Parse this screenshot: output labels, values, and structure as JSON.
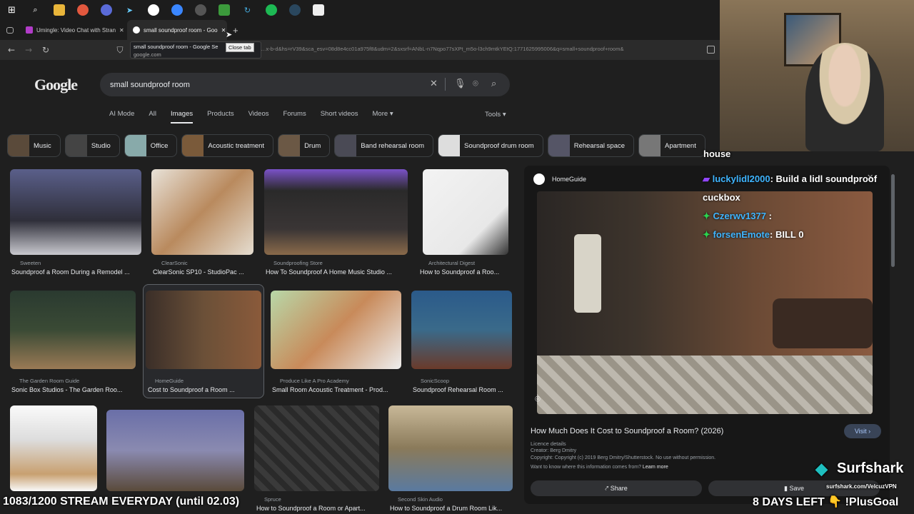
{
  "browser": {
    "tabs": [
      {
        "label": "Umingle: Video Chat with Stran",
        "active": false
      },
      {
        "label": "small soundproof room - Goo",
        "active": true
      }
    ],
    "new_tab": "+",
    "url": "…x-b-d&hs=rV39&sca_esv=08d8e4cc01a975f8&udm=2&sxsrf=ANbL-n7Nqpo77sXPt_m5o-l3ch9mtkYEtQ:1771625995006&q=small+soundproof+room&",
    "tooltip_title": "small soundproof room - Google Se",
    "tooltip_domain": "google.com",
    "close_tab_tip": "Close tab"
  },
  "google": {
    "logo": "Google",
    "query": "small soundproof room",
    "filters": [
      "AI Mode",
      "All",
      "Images",
      "Products",
      "Videos",
      "Forums",
      "Short videos",
      "More"
    ],
    "selected_filter": "Images",
    "tools": "Tools",
    "chips": [
      "Music",
      "Studio",
      "Office",
      "Acoustic treatment",
      "Drum",
      "Band rehearsal room",
      "Soundproof drum room",
      "Rehearsal space",
      "Apartment"
    ],
    "results": [
      {
        "source": "Sweeten",
        "title": "Soundproof a Room During a Remodel ..."
      },
      {
        "source": "ClearSonic",
        "title": "ClearSonic SP10 - StudioPac ..."
      },
      {
        "source": "Soundproofing Store",
        "title": "How To Soundproof A Home Music Studio ..."
      },
      {
        "source": "Architectural Digest",
        "title": "How to Soundproof a Roo..."
      },
      {
        "source": "The Garden Room Guide",
        "title": "Sonic Box Studios - The Garden Roo..."
      },
      {
        "source": "HomeGuide",
        "title": "Cost to Soundproof a Room ..."
      },
      {
        "source": "Produce Like A Pro Academy",
        "title": "Small Room Acoustic Treatment - Prod..."
      },
      {
        "source": "SonicScoop",
        "title": "Soundproof Rehearsal Room ..."
      },
      {
        "source": "Spruce",
        "title": "How to Soundproof a Room or Apart..."
      },
      {
        "source": "Second Skin Audio",
        "title": "How to Soundproof a Drum Room Lik..."
      }
    ],
    "panel": {
      "source": "HomeGuide",
      "title": "How Much Does It Cost to Soundproof a Room? (2026)",
      "visit": "Visit",
      "licence_label": "Licence details",
      "creator": "Creator: Berg Dmitry",
      "copyright": "Copyright: Copyright (c) 2019 Berg Dmitry/Shutterstock. No use without permission.",
      "want_to_know": "Want to know where this information comes from?",
      "learn_more": "Learn more",
      "share": "Share",
      "save": "Save"
    }
  },
  "overlay": {
    "chat_cut": "house",
    "chat1_user": "luckylidl2000",
    "chat1_msg": ": Build a lidl soundproof cuckbox",
    "chat2_user": "Czerwv1377",
    "chat3_user": "forsenEmote",
    "chat3_msg": ": BILL 0",
    "stream_counter": "1083/1200 STREAM EVERYDAY (until 02.03)",
    "days_left": "8 DAYS LEFT",
    "goal": "!PlusGoal",
    "surfshark": "Surfshark",
    "surfshark_url": "surfshark.com/VelcuzVPN"
  },
  "colors": {
    "accent": "#8ab4f8",
    "bg": "#1f1f1f",
    "twitch": "#9146ff",
    "chat_user": "#3fb5ff"
  }
}
